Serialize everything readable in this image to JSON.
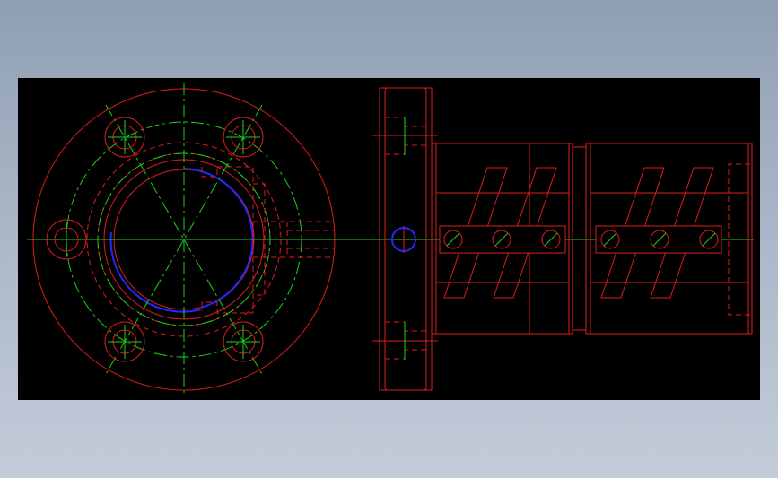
{
  "drawing": {
    "background": "#000000",
    "colors": {
      "outline": "#e01c1c",
      "centerline": "#19d219",
      "highlight": "#2626ff"
    },
    "views": [
      "front-view-flange",
      "side-view-ball-nut"
    ]
  }
}
